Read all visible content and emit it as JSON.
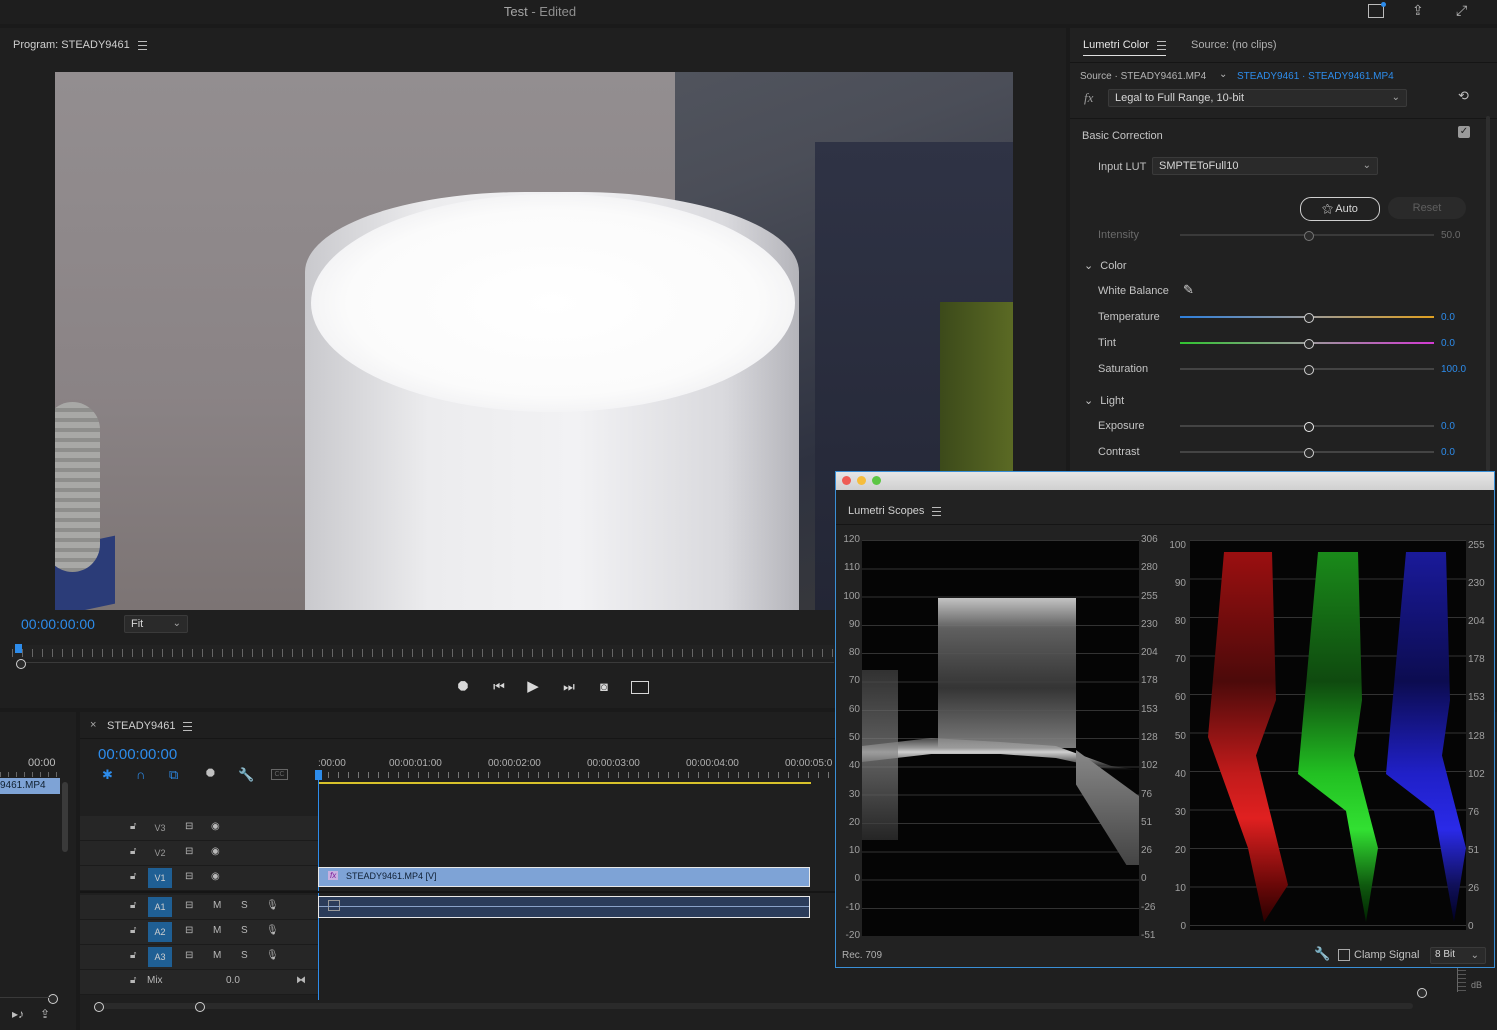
{
  "window": {
    "title": "Test",
    "title_state": "- Edited"
  },
  "program_monitor": {
    "panel_title": "Program: STEADY9461",
    "timecode": "00:00:00:00",
    "zoom": "Fit",
    "playhead_fraction": 0.0
  },
  "lumetri_color": {
    "tab_active": "Lumetri Color",
    "tab_source": "Source: (no clips)",
    "source_label": "Source · STEADY9461.MP4",
    "clip_link": "STEADY9461 · STEADY9461.MP4",
    "fx_label": "fx",
    "fx_preset": "Legal to Full Range, 10-bit",
    "basic_correction": "Basic Correction",
    "input_lut_label": "Input LUT",
    "input_lut_value": "SMPTEToFull10",
    "auto_button": "Auto",
    "reset_button": "Reset",
    "intensity_label": "Intensity",
    "intensity_value": "50.0",
    "color_section": "Color",
    "white_balance_label": "White Balance",
    "temperature_label": "Temperature",
    "temperature_value": "0.0",
    "tint_label": "Tint",
    "tint_value": "0.0",
    "saturation_label": "Saturation",
    "saturation_value": "100.0",
    "light_section": "Light",
    "exposure_label": "Exposure",
    "exposure_value": "0.0",
    "contrast_label": "Contrast",
    "contrast_value": "0.0"
  },
  "lumetri_scopes": {
    "title": "Lumetri Scopes",
    "waveform_left_ticks": [
      "120",
      "110",
      "100",
      "90",
      "80",
      "70",
      "60",
      "50",
      "40",
      "30",
      "20",
      "10",
      "0",
      "-10",
      "-20"
    ],
    "waveform_right_ticks": [
      "306",
      "280",
      "255",
      "230",
      "204",
      "178",
      "153",
      "128",
      "102",
      "76",
      "51",
      "26",
      "0",
      "-26",
      "-51"
    ],
    "parade_left_ticks": [
      "100",
      "90",
      "80",
      "70",
      "60",
      "50",
      "40",
      "30",
      "20",
      "10",
      "0"
    ],
    "parade_right_ticks": [
      "255",
      "230",
      "204",
      "178",
      "153",
      "128",
      "102",
      "76",
      "51",
      "26",
      "0"
    ],
    "color_space": "Rec. 709",
    "clamp_signal": "Clamp Signal",
    "bit_depth": "8 Bit"
  },
  "sequence": {
    "tab_name": "STEADY9461",
    "timecode": "00:00:00:00",
    "ruler_labels": [
      ":00:00",
      "00:00:01:00",
      "00:00:02:00",
      "00:00:03:00",
      "00:00:04:00",
      "00:00:05:0"
    ],
    "tracks_video": [
      {
        "label": "V3"
      },
      {
        "label": "V2"
      },
      {
        "label": "V1"
      }
    ],
    "tracks_audio": [
      {
        "label": "A1"
      },
      {
        "label": "A2"
      },
      {
        "label": "A3"
      }
    ],
    "mute_label": "M",
    "solo_label": "S",
    "mix_label": "Mix",
    "mix_value": "0.0",
    "clip_video": "STEADY9461.MP4 [V]",
    "clip_fx": "fx"
  },
  "project_panel": {
    "timecode": "00:00",
    "clip_name": "9461.MP4"
  },
  "audio_meter": {
    "unit": "dB"
  },
  "colors": {
    "accent_blue": "#2d8ceb",
    "clip_blue": "#7ea3d6",
    "track_active": "#1f5f94",
    "timeline_yellow": "#d8c22b"
  }
}
